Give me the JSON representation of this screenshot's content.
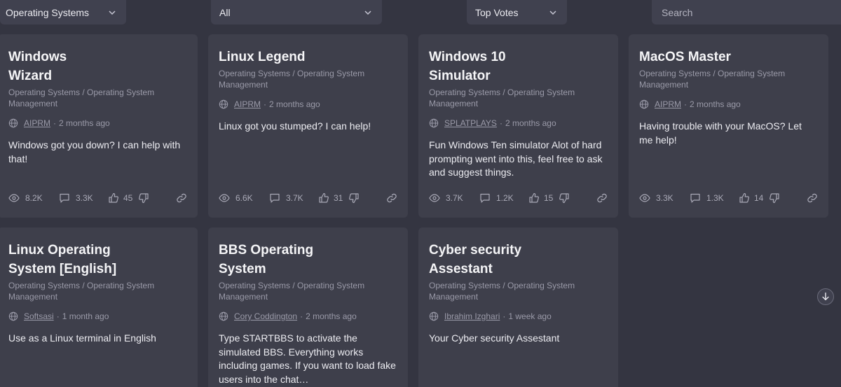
{
  "filters": {
    "topic": "Operating Systems",
    "activity": "All",
    "sort": "Top Votes",
    "search_placeholder": "Search"
  },
  "cards": [
    {
      "title": "Windows Wizard",
      "category": "Operating Systems / Operating System Management",
      "author": "AIPRM",
      "time": "2 months ago",
      "description": "Windows got you down? I can help with that!",
      "views": "8.2K",
      "comments": "3.3K",
      "votes": "45"
    },
    {
      "title": "Linux Legend",
      "category": "Operating Systems / Operating System Management",
      "author": "AIPRM",
      "time": "2 months ago",
      "description": "Linux got you stumped? I can help!",
      "views": "6.6K",
      "comments": "3.7K",
      "votes": "31"
    },
    {
      "title": "Windows 10 Simulator",
      "category": "Operating Systems / Operating System Management",
      "author": "SPLATPLAYS",
      "time": "2 months ago",
      "description": "Fun Windows Ten simulator Alot of hard prompting went into this, feel free to ask and suggest things.",
      "views": "3.7K",
      "comments": "1.2K",
      "votes": "15"
    },
    {
      "title": "MacOS Master",
      "category": "Operating Systems / Operating System Management",
      "author": "AIPRM",
      "time": "2 months ago",
      "description": "Having trouble with your MacOS? Let me help!",
      "views": "3.3K",
      "comments": "1.3K",
      "votes": "14"
    },
    {
      "title": "Linux Operating System [English]",
      "category": "Operating Systems / Operating System Management",
      "author": "Softsasi",
      "time": "1 month ago",
      "description": "Use as a Linux terminal in English"
    },
    {
      "title": "BBS Operating System",
      "category": "Operating Systems / Operating System Management",
      "author": "Cory Coddington",
      "time": "2 months ago",
      "description": "Type STARTBBS to activate the simulated BBS. Everything works including games. If you want to load fake users into the chat…"
    },
    {
      "title": "Cyber security Assestant",
      "category": "Operating Systems / Operating System Management",
      "author": "Ibrahim Izghari",
      "time": "1 week ago",
      "description": "Your Cyber security Assestant"
    }
  ]
}
